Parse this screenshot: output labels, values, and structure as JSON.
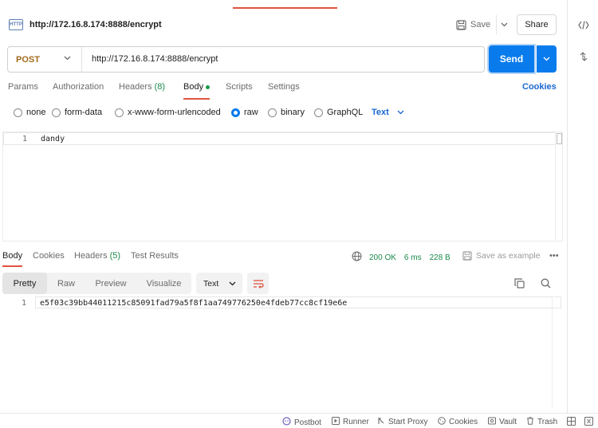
{
  "request": {
    "title": "http://172.16.8.174:8888/encrypt",
    "http_badge": "HTTP",
    "method": "POST",
    "url": "http://172.16.8.174:8888/encrypt",
    "save_label": "Save",
    "share_label": "Share",
    "send_label": "Send"
  },
  "request_tabs": [
    {
      "label": "Params"
    },
    {
      "label": "Authorization"
    },
    {
      "label": "Headers",
      "count": "(8)"
    },
    {
      "label": "Body"
    },
    {
      "label": "Scripts"
    },
    {
      "label": "Settings"
    }
  ],
  "cookies_label": "Cookies",
  "body_types": [
    "none",
    "form-data",
    "x-www-form-urlencoded",
    "raw",
    "binary",
    "GraphQL"
  ],
  "body_type_selected": "raw",
  "body_format": "Text",
  "request_body": {
    "line_number": "1",
    "content": "dandy"
  },
  "response_tabs": [
    {
      "label": "Body"
    },
    {
      "label": "Cookies"
    },
    {
      "label": "Headers",
      "count": "(5)"
    },
    {
      "label": "Test Results"
    }
  ],
  "response_status": {
    "status": "200 OK",
    "time": "6 ms",
    "size": "228 B"
  },
  "save_example_label": "Save as example",
  "more_label": "•••",
  "view_modes": [
    "Pretty",
    "Raw",
    "Preview",
    "Visualize"
  ],
  "view_mode_selected": "Pretty",
  "response_format": "Text",
  "response_body": {
    "line_number": "1",
    "content": "e5f03c39bb44011215c85091fad79a5f8f1aa749776250e4fdeb77cc8cf19e6e"
  },
  "status_bar": [
    {
      "label": "Postbot",
      "icon": "postbot-icon"
    },
    {
      "label": "Runner",
      "icon": "runner-icon"
    },
    {
      "label": "Start Proxy",
      "icon": "proxy-icon"
    },
    {
      "label": "Cookies",
      "icon": "cookie-icon"
    },
    {
      "label": "Vault",
      "icon": "vault-icon"
    },
    {
      "label": "Trash",
      "icon": "trash-icon"
    }
  ],
  "colors": {
    "accent": "#e0533f",
    "send": "#097bed",
    "link": "#1967d2",
    "method": "#a46b1b",
    "success": "#1a8a4a"
  }
}
